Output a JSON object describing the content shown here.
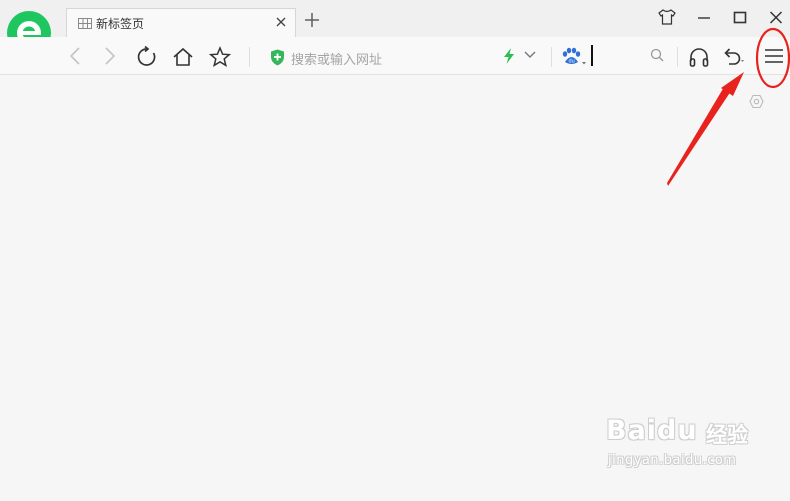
{
  "tab": {
    "title": "新标签页"
  },
  "address_bar": {
    "placeholder": "搜索或输入网址"
  },
  "watermark": {
    "brand": "Baidu",
    "brand_cn": "经验",
    "url": "jingyan.baidu.com"
  },
  "colors": {
    "logo_green": "#1ec65f",
    "shield_green": "#35b65a",
    "lightning_green": "#2dbe52",
    "annotation_red": "#e8231e",
    "paw_blue": "#2f6fd6"
  },
  "icons": [
    "browser-logo-icon",
    "tab-grid-icon",
    "close-icon",
    "plus-icon",
    "skin-icon",
    "minimize-icon",
    "maximize-icon",
    "window-close-icon",
    "back-icon",
    "forward-icon",
    "refresh-icon",
    "home-icon",
    "star-icon",
    "shield-icon",
    "lightning-icon",
    "chevron-down-icon",
    "baidu-paw-icon",
    "search-icon",
    "headphone-icon",
    "undo-icon",
    "menu-icon",
    "settings-hex-icon"
  ]
}
